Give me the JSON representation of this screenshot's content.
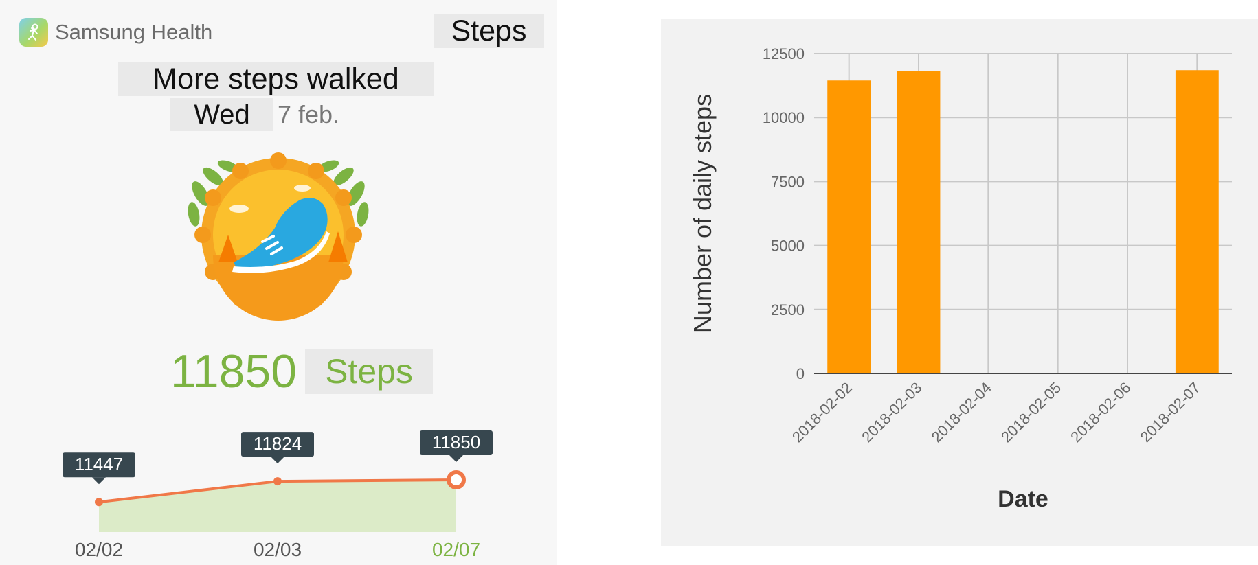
{
  "app": {
    "name": "Samsung Health",
    "title": "Steps"
  },
  "achievement": {
    "headline": "More steps walked",
    "weekday": "Wed",
    "date": "7 feb.",
    "steps_value": "11850",
    "steps_unit": "Steps"
  },
  "trend": {
    "points": [
      {
        "label": "02/02",
        "value": 11447,
        "value_text": "11447"
      },
      {
        "label": "02/03",
        "value": 11824,
        "value_text": "11824"
      },
      {
        "label": "02/07",
        "value": 11850,
        "value_text": "11850"
      }
    ],
    "colors": {
      "line": "#f07848",
      "fill": "#dcebc8",
      "tooltip": "#37474f",
      "highlight_label": "#7cb342"
    }
  },
  "chart_data": {
    "type": "bar",
    "categories": [
      "2018-02-02",
      "2018-02-03",
      "2018-02-04",
      "2018-02-05",
      "2018-02-06",
      "2018-02-07"
    ],
    "values": [
      11447,
      11824,
      0,
      0,
      0,
      11850
    ],
    "xlabel": "Date",
    "ylabel": "Number of daily steps",
    "ylim": [
      0,
      12500
    ],
    "yticks": [
      "0",
      "2500",
      "5000",
      "7500",
      "10000",
      "12500"
    ],
    "grid": true,
    "bar_color": "#ff9800"
  }
}
